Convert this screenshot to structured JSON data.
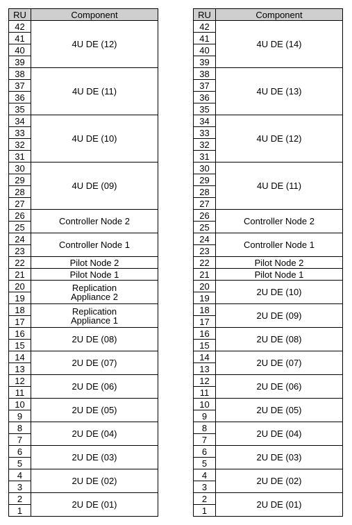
{
  "headers": {
    "ru": "RU",
    "component": "Component"
  },
  "left": [
    {
      "rus": [
        42,
        41,
        40,
        39
      ],
      "component": "4U DE (12)"
    },
    {
      "rus": [
        38,
        37,
        36,
        35
      ],
      "component": "4U DE (11)"
    },
    {
      "rus": [
        34,
        33,
        32,
        31
      ],
      "component": "4U DE (10)"
    },
    {
      "rus": [
        30,
        29,
        28,
        27
      ],
      "component": "4U DE (09)"
    },
    {
      "rus": [
        26,
        25
      ],
      "component": "Controller Node 2"
    },
    {
      "rus": [
        24,
        23
      ],
      "component": "Controller Node 1"
    },
    {
      "rus": [
        22
      ],
      "component": "Pilot Node 2"
    },
    {
      "rus": [
        21
      ],
      "component": "Pilot Node 1"
    },
    {
      "rus": [
        20,
        19
      ],
      "component": "Replication\nAppliance 2"
    },
    {
      "rus": [
        18,
        17
      ],
      "component": "Replication\nAppliance 1"
    },
    {
      "rus": [
        16,
        15
      ],
      "component": "2U DE (08)"
    },
    {
      "rus": [
        14,
        13
      ],
      "component": "2U DE (07)"
    },
    {
      "rus": [
        12,
        11
      ],
      "component": "2U DE (06)"
    },
    {
      "rus": [
        10,
        9
      ],
      "component": "2U DE (05)"
    },
    {
      "rus": [
        8,
        7
      ],
      "component": "2U DE (04)"
    },
    {
      "rus": [
        6,
        5
      ],
      "component": "2U DE (03)"
    },
    {
      "rus": [
        4,
        3
      ],
      "component": "2U DE (02)"
    },
    {
      "rus": [
        2,
        1
      ],
      "component": "2U DE (01)"
    }
  ],
  "right": [
    {
      "rus": [
        42,
        41,
        40,
        39
      ],
      "component": "4U DE (14)"
    },
    {
      "rus": [
        38,
        37,
        36,
        35
      ],
      "component": "4U DE (13)"
    },
    {
      "rus": [
        34,
        33,
        32,
        31
      ],
      "component": "4U DE (12)"
    },
    {
      "rus": [
        30,
        29,
        28,
        27
      ],
      "component": "4U DE (11)"
    },
    {
      "rus": [
        26,
        25
      ],
      "component": "Controller Node 2"
    },
    {
      "rus": [
        24,
        23
      ],
      "component": "Controller Node 1"
    },
    {
      "rus": [
        22
      ],
      "component": "Pilot Node 2"
    },
    {
      "rus": [
        21
      ],
      "component": "Pilot Node 1"
    },
    {
      "rus": [
        20,
        19
      ],
      "component": "2U DE (10)"
    },
    {
      "rus": [
        18,
        17
      ],
      "component": "2U DE (09)"
    },
    {
      "rus": [
        16,
        15
      ],
      "component": "2U DE (08)"
    },
    {
      "rus": [
        14,
        13
      ],
      "component": "2U DE (07)"
    },
    {
      "rus": [
        12,
        11
      ],
      "component": "2U DE (06)"
    },
    {
      "rus": [
        10,
        9
      ],
      "component": "2U DE (05)"
    },
    {
      "rus": [
        8,
        7
      ],
      "component": "2U DE (04)"
    },
    {
      "rus": [
        6,
        5
      ],
      "component": "2U DE (03)"
    },
    {
      "rus": [
        4,
        3
      ],
      "component": "2U DE (02)"
    },
    {
      "rus": [
        2,
        1
      ],
      "component": "2U DE (01)"
    }
  ]
}
